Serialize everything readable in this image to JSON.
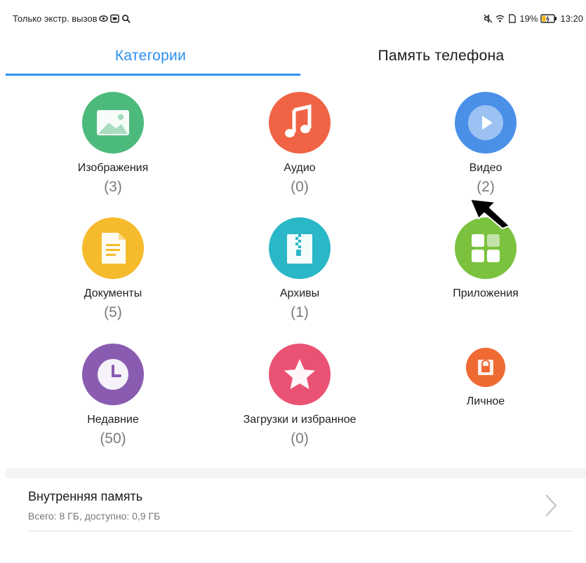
{
  "status_bar": {
    "left_text": "Только экстр. вызов",
    "battery": "19%",
    "time": "13:20"
  },
  "tabs": [
    {
      "label": "Категории",
      "active": true
    },
    {
      "label": "Память телефона",
      "active": false
    }
  ],
  "categories": [
    {
      "label": "Изображения",
      "count": "(3)",
      "color": "#4cba7d",
      "icon": "image-icon"
    },
    {
      "label": "Аудио",
      "count": "(0)",
      "color": "#f06445",
      "icon": "music-note-icon"
    },
    {
      "label": "Видео",
      "count": "(2)",
      "color": "#4a90e8",
      "icon": "play-icon"
    },
    {
      "label": "Документы",
      "count": "(5)",
      "color": "#f6bb2c",
      "icon": "document-icon"
    },
    {
      "label": "Архивы",
      "count": "(1)",
      "color": "#2ab7c7",
      "icon": "archive-icon"
    },
    {
      "label": "Приложения",
      "count": "",
      "color": "#7bc23e",
      "icon": "apps-icon"
    },
    {
      "label": "Недавние",
      "count": "(50)",
      "color": "#8a5cb1",
      "icon": "clock-icon"
    },
    {
      "label": "Загрузки и избранное",
      "count": "(0)",
      "color": "#ea5273",
      "icon": "star-icon"
    },
    {
      "label": "Личное",
      "count": "",
      "color": "#ef6a33",
      "icon": "lock-icon"
    }
  ],
  "storage": {
    "title": "Внутренняя память",
    "subtitle": "Всего: 8 ГБ, доступно: 0,9 ГБ"
  }
}
